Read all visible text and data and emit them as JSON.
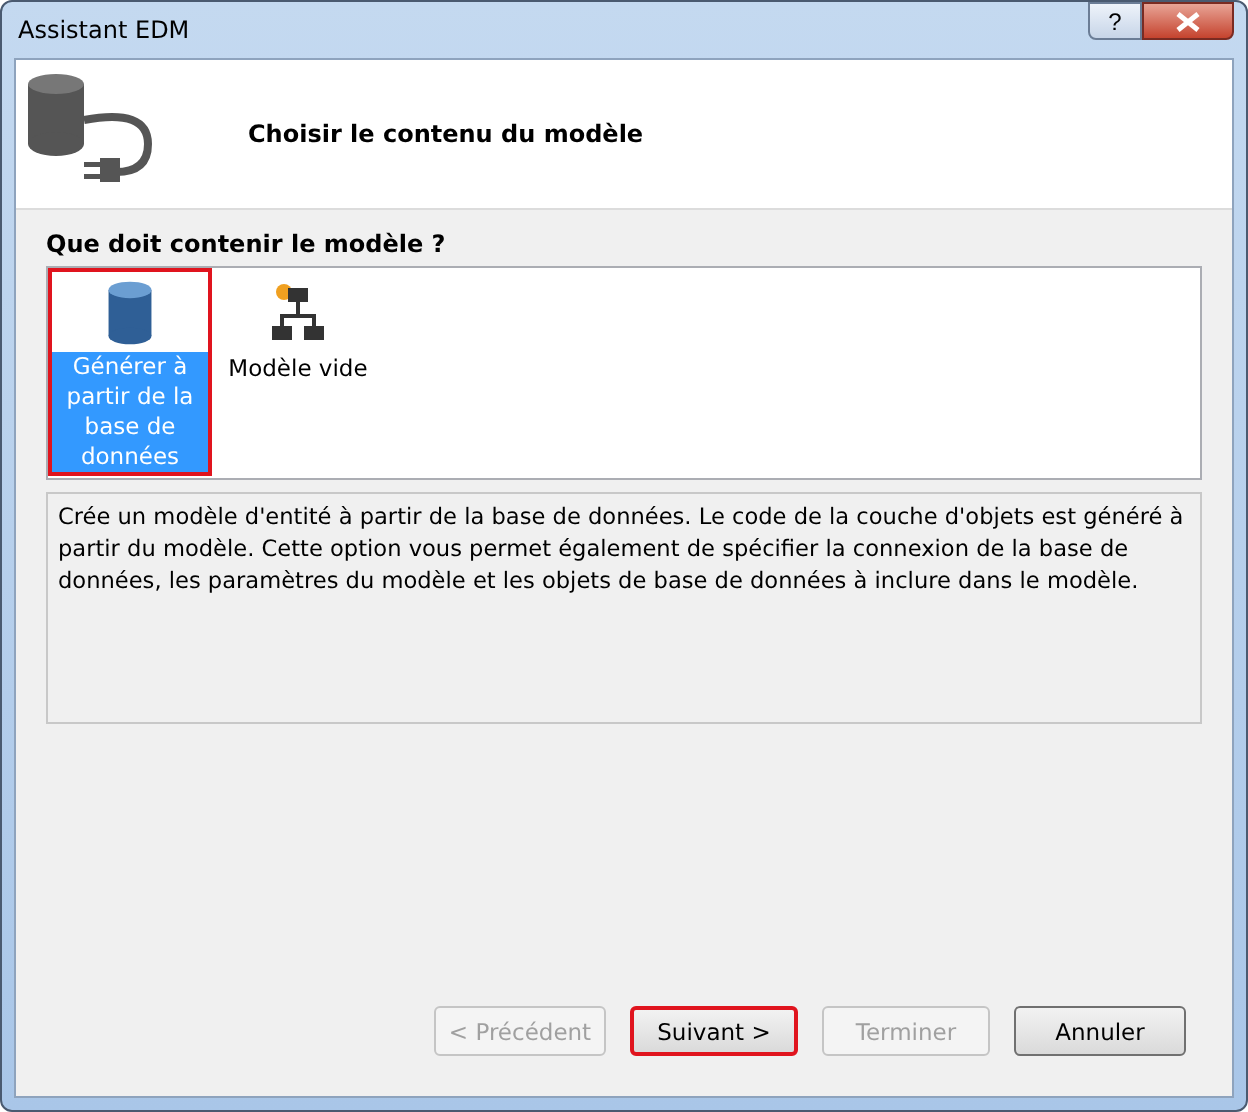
{
  "window": {
    "title": "Assistant EDM",
    "help_button": "?"
  },
  "header": {
    "title": "Choisir le contenu du modèle"
  },
  "section_label": "Que doit contenir le modèle ?",
  "options": [
    {
      "kind": "database",
      "label": "Générer à partir de la base de données",
      "selected": true,
      "highlighted": true
    },
    {
      "kind": "empty",
      "label": "Modèle vide",
      "selected": false,
      "highlighted": false
    }
  ],
  "description": "Crée un modèle d'entité à partir de la base de données. Le code de la couche d'objets est généré à partir du modèle. Cette option vous permet également de spécifier la connexion de la base de données, les paramètres du modèle et les objets de base de données à inclure dans le modèle.",
  "buttons": [
    {
      "label": "< Précédent",
      "disabled": true,
      "highlighted": false
    },
    {
      "label": "Suivant >",
      "disabled": false,
      "highlighted": true
    },
    {
      "label": "Terminer",
      "disabled": true,
      "highlighted": false
    },
    {
      "label": "Annuler",
      "disabled": false,
      "highlighted": false
    }
  ]
}
